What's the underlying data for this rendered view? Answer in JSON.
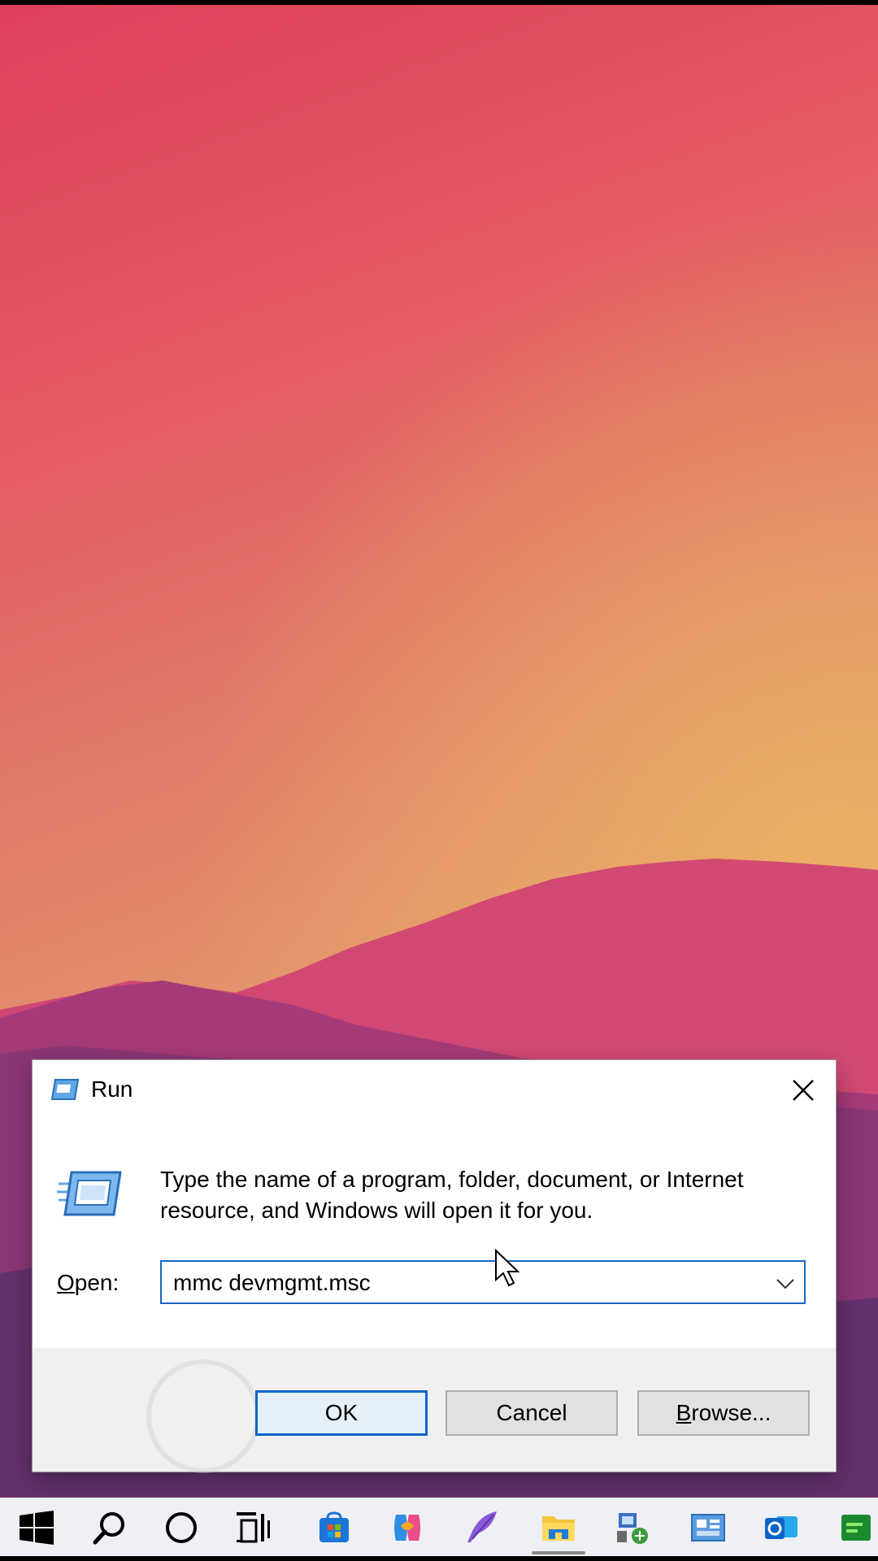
{
  "dialog": {
    "title": "Run",
    "description": "Type the name of a program, folder, document, or Internet resource, and Windows will open it for you.",
    "open_label_accel": "O",
    "open_label_rest": "pen:",
    "command_value": "mmc devmgmt.msc",
    "buttons": {
      "ok": "OK",
      "cancel": "Cancel",
      "browse_accel": "B",
      "browse_rest": "rowse..."
    }
  },
  "taskbar": {
    "items": [
      "start-icon",
      "search-icon",
      "cortana-icon",
      "task-view-icon",
      "store-icon",
      "copilot-icon",
      "feather-app-icon",
      "file-explorer-icon",
      "network-app-icon",
      "control-panel-icon",
      "outlook-icon",
      "terminal-app-icon"
    ],
    "active_item": "file-explorer-icon"
  },
  "colors": {
    "accent": "#0a64c8",
    "taskbar": "#eef0f6",
    "dialog_footer": "#f0f0f0"
  }
}
